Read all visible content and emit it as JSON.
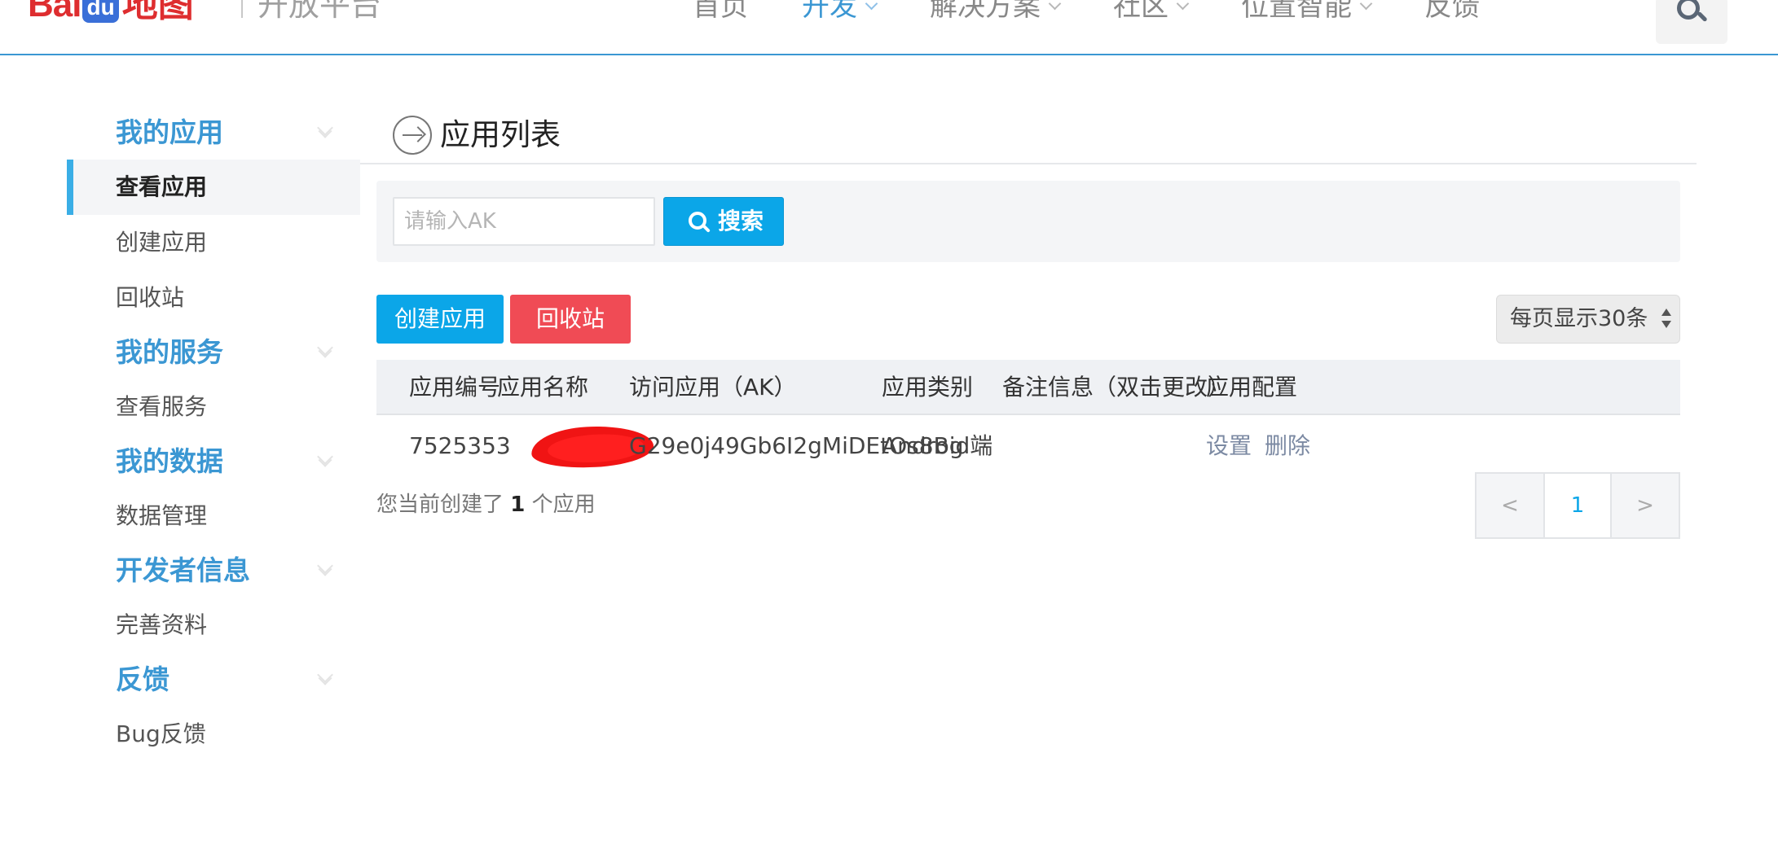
{
  "header": {
    "logo_text": "Bai",
    "logo_badge": "du",
    "logo_map": "地图",
    "subtitle": "开放平台",
    "nav": [
      {
        "label": "首页",
        "has_menu": false,
        "active": false
      },
      {
        "label": "开发",
        "has_menu": true,
        "active": true
      },
      {
        "label": "解决方案",
        "has_menu": true,
        "active": false
      },
      {
        "label": "社区",
        "has_menu": true,
        "active": false
      },
      {
        "label": "位置智能",
        "has_menu": true,
        "active": false
      },
      {
        "label": "反馈",
        "has_menu": false,
        "active": false
      }
    ],
    "accent_color": "#3b97d3",
    "search_icon": "search-icon"
  },
  "sidebar": {
    "groups": [
      {
        "title": "我的应用",
        "items": [
          {
            "label": "查看应用",
            "active": true
          },
          {
            "label": "创建应用"
          },
          {
            "label": "回收站"
          }
        ]
      },
      {
        "title": "我的服务",
        "items": [
          {
            "label": "查看服务"
          }
        ]
      },
      {
        "title": "我的数据",
        "items": [
          {
            "label": "数据管理"
          }
        ]
      },
      {
        "title": "开发者信息",
        "items": [
          {
            "label": "完善资料"
          }
        ]
      },
      {
        "title": "反馈",
        "items": [
          {
            "label": "Bug反馈"
          }
        ]
      }
    ]
  },
  "main": {
    "title": "应用列表",
    "search": {
      "placeholder": "请输入AK",
      "value": "",
      "button_label": "搜索"
    },
    "create_button": "创建应用",
    "recycle_button": "回收站",
    "page_size_label": "每页显示30条",
    "table": {
      "headers": [
        "应用编号",
        "应用名称",
        "访问应用（AK）",
        "应用类别",
        "备注信息（双击更改）",
        "应用配置"
      ],
      "rows": [
        {
          "id": "7525353",
          "name": "",
          "ak": "G29e0j49Gb6I2gMiDEtOs8Bg",
          "category": "Android端",
          "note": "",
          "actions": [
            "设置",
            "删除"
          ]
        }
      ]
    },
    "summary_prefix": "您当前创建了",
    "summary_count": "1",
    "summary_suffix": "个应用",
    "pager": {
      "prev": "<",
      "current": "1",
      "next": ">"
    }
  },
  "colors": {
    "primary_button": "#0ba6e8",
    "danger_button": "#f04b55",
    "active_indicator": "#3aaee6",
    "redaction": "#f01414"
  }
}
